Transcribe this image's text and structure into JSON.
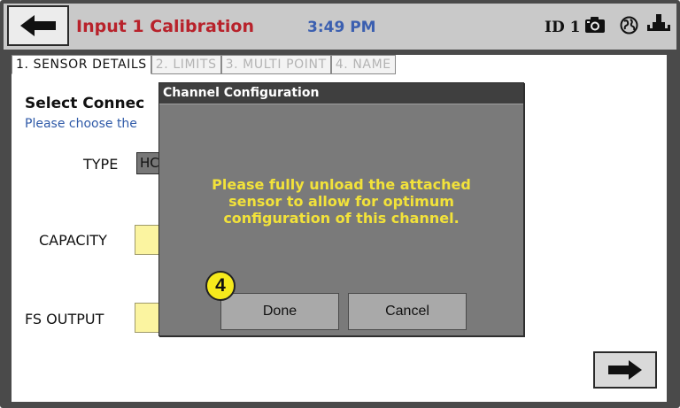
{
  "header": {
    "title": "Input 1 Calibration",
    "time": "3:49 PM",
    "device_id": "ID 1",
    "back_icon": "arrow-left-icon",
    "camera_icon": "camera-icon",
    "network_icon": "globe-icon",
    "usb_icon": "usb-plug-icon"
  },
  "tabs": [
    {
      "label": "1. SENSOR DETAILS",
      "active": true
    },
    {
      "label": "2. LIMITS",
      "active": false
    },
    {
      "label": "3. MULTI POINT",
      "active": false
    },
    {
      "label": "4. NAME",
      "active": false
    }
  ],
  "form": {
    "section_title": "Select Connec",
    "section_subtitle": "Please choose the",
    "type_label": "TYPE",
    "type_value": "HC",
    "capacity_label": "CAPACITY",
    "fs_output_label": "FS OUTPUT",
    "next_icon": "arrow-right-icon"
  },
  "dialog": {
    "title": "Channel Configuration",
    "message_lines": [
      "Please fully unload the attached",
      "sensor to allow for optimum",
      "configuration of this channel."
    ],
    "done_label": "Done",
    "cancel_label": "Cancel"
  },
  "callout": {
    "step": "4"
  },
  "colors": {
    "title_red": "#b8222b",
    "time_blue": "#3b5fb0",
    "dialog_text_yellow": "#f2e23a",
    "callout_yellow": "#f6ea1c",
    "input_yellow": "#fbf4a0"
  }
}
